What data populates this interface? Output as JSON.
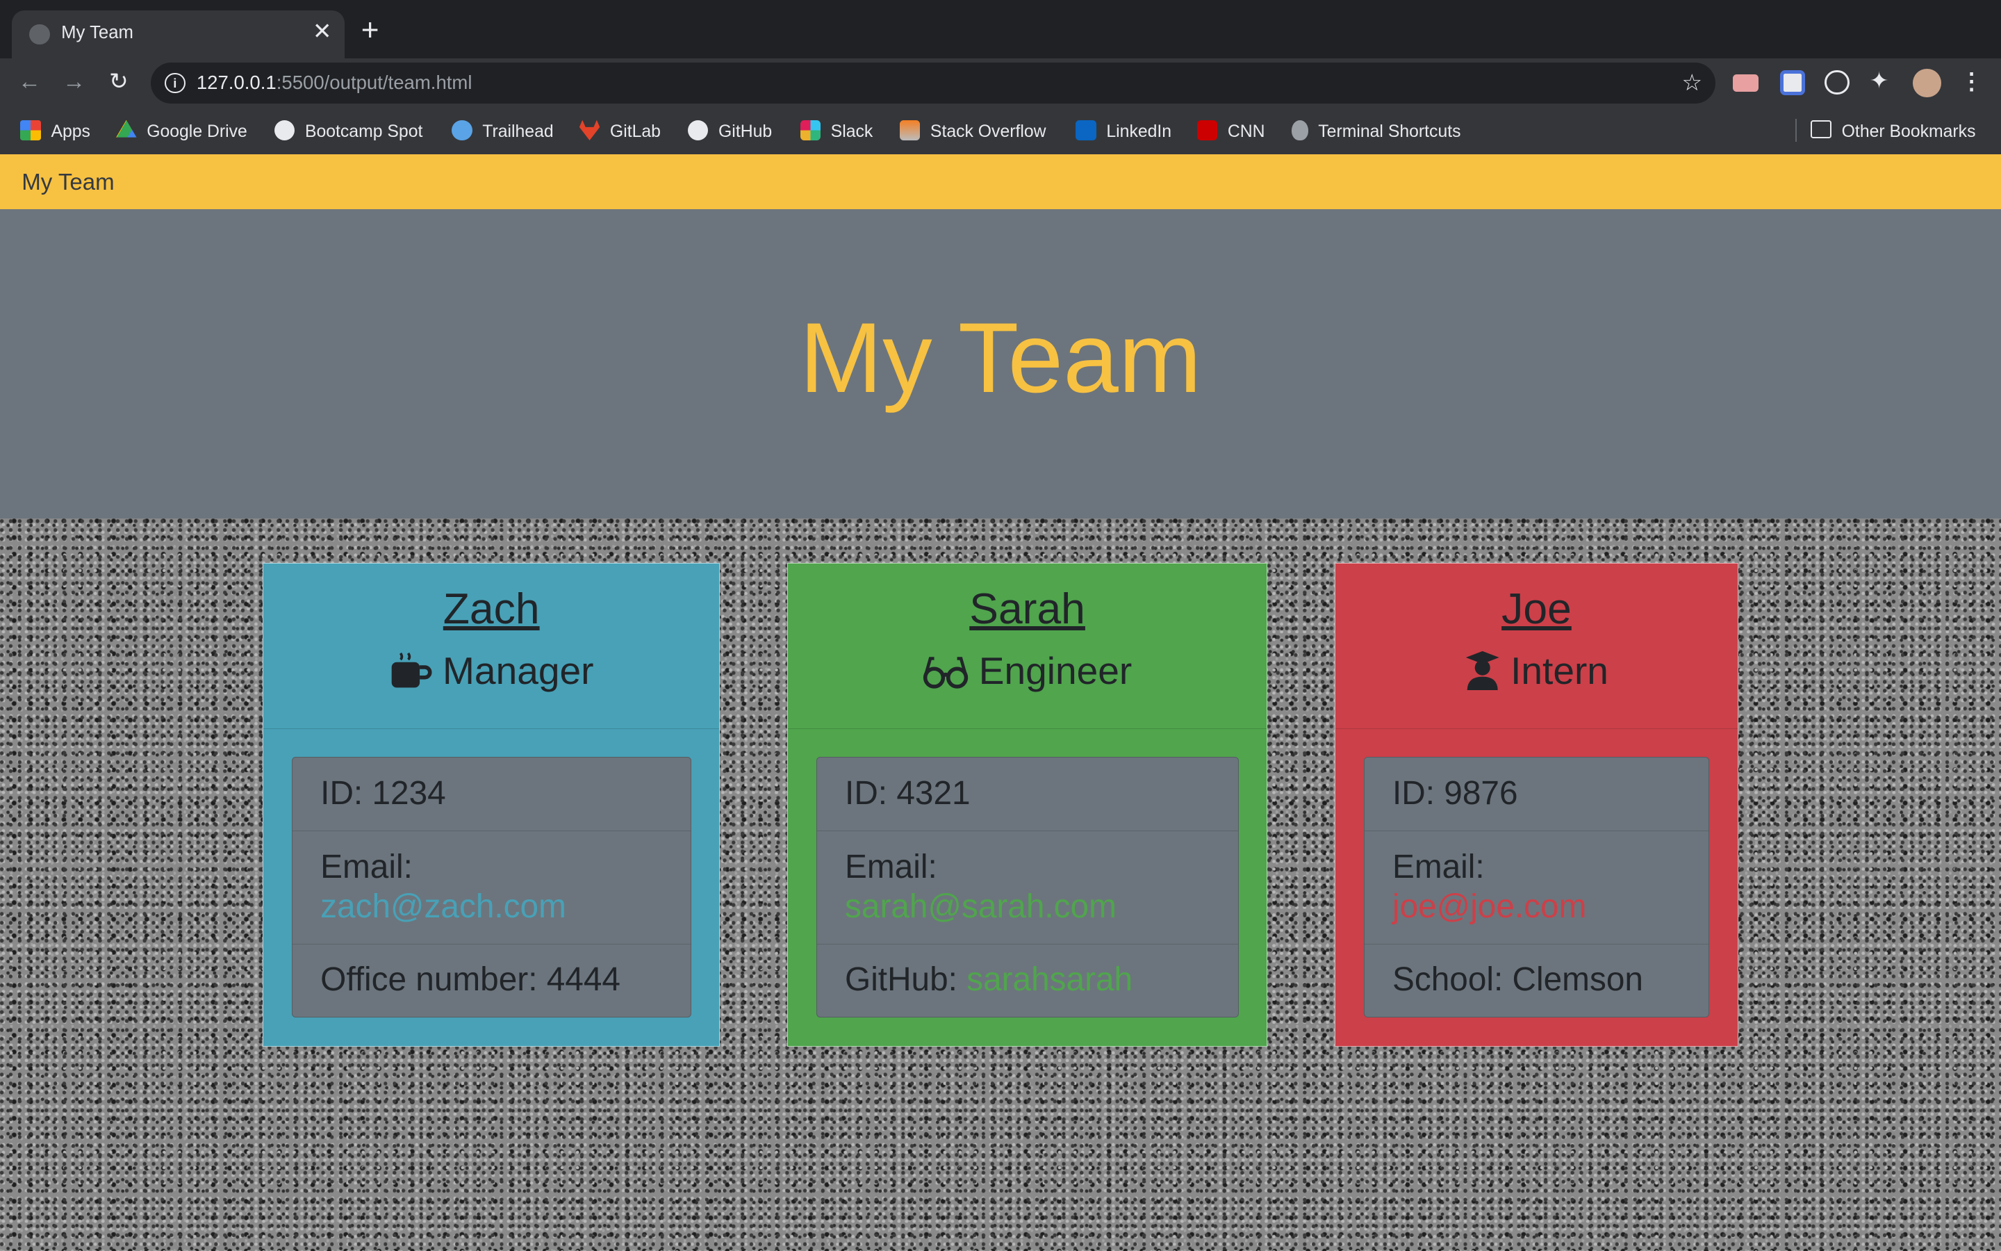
{
  "browser": {
    "tab_title": "My Team",
    "url_host": "127.0.0.1",
    "url_rest": ":5500/output/team.html",
    "bookmarks": [
      "Apps",
      "Google Drive",
      "Bootcamp Spot",
      "Trailhead",
      "GitLab",
      "GitHub",
      "Slack",
      "Stack Overflow",
      "LinkedIn",
      "CNN",
      "Terminal Shortcuts"
    ],
    "other_bookmarks": "Other Bookmarks"
  },
  "navbar": {
    "brand": "My Team"
  },
  "jumbotron": {
    "title": "My Team"
  },
  "colors": {
    "navbar": "#f7c142",
    "jumbotron": "#6c757d",
    "manager": "#48a1b7",
    "engineer": "#50a54d",
    "intern": "#cc4049"
  },
  "team": [
    {
      "name": "Zach",
      "role": "Manager",
      "role_icon": "coffee-icon",
      "id_line": "ID: 1234",
      "email_label": "Email:",
      "email": "zach@zach.com",
      "extra_label": "Office number: 4444",
      "extra_value": ""
    },
    {
      "name": "Sarah",
      "role": "Engineer",
      "role_icon": "glasses-icon",
      "id_line": "ID: 4321",
      "email_label": "Email:",
      "email": "sarah@sarah.com",
      "extra_label": "GitHub: ",
      "extra_value": "sarahsarah"
    },
    {
      "name": "Joe",
      "role": "Intern",
      "role_icon": "graduate-icon",
      "id_line": "ID: 9876",
      "email_label": "Email:",
      "email": "joe@joe.com",
      "extra_label": "School: Clemson",
      "extra_value": ""
    }
  ]
}
